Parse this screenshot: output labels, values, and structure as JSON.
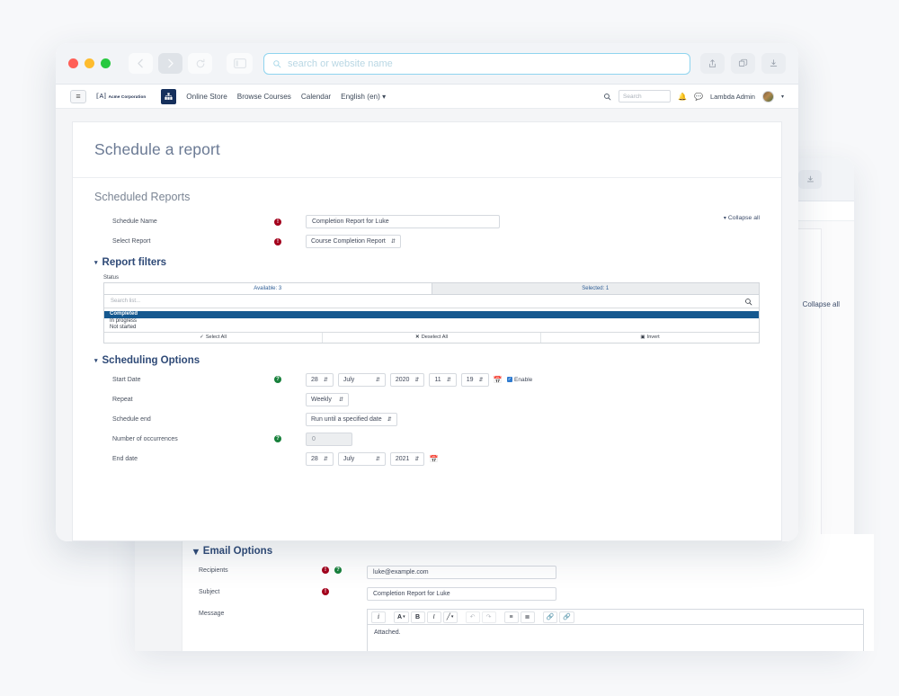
{
  "browser": {
    "url_placeholder": "search or website name",
    "buttons": {
      "back": "back-icon",
      "forward": "forward-icon",
      "reload": "reload-icon",
      "sidebar": "sidebar-icon",
      "share": "share-icon",
      "tabs": "tabs-icon",
      "download": "download-icon"
    }
  },
  "sitenav": {
    "menu": "≡",
    "brand": "Acme Corporation",
    "links": [
      "Online Store",
      "Browse Courses",
      "Calendar",
      "English (en)"
    ],
    "lang_caret": "▾",
    "search_placeholder": "Search",
    "user": "Lambda Admin",
    "user_caret": "▾"
  },
  "page": {
    "title": "Schedule a report",
    "section_title": "Scheduled Reports",
    "collapse_all": "Collapse all"
  },
  "form": {
    "schedule_name": {
      "label": "Schedule Name",
      "value": "Completion Report for Luke"
    },
    "select_report": {
      "label": "Select Report",
      "value": "Course Completion Report"
    }
  },
  "report_filters": {
    "heading": "Report filters",
    "status_label": "Status",
    "tab_available": "Available: 3",
    "tab_selected": "Selected: 1",
    "search_placeholder": "Search list...",
    "items": [
      "Completed",
      "In progress",
      "Not started"
    ],
    "selected_item": "Completed",
    "buttons": {
      "select_all": "Select All",
      "deselect_all": "Deselect All",
      "invert": "Invert"
    }
  },
  "scheduling": {
    "heading": "Scheduling Options",
    "start_date": {
      "label": "Start Date",
      "day": "28",
      "month": "July",
      "year": "2020",
      "hour": "11",
      "minute": "19",
      "enable_label": "Enable",
      "enabled": true
    },
    "repeat": {
      "label": "Repeat",
      "value": "Weekly"
    },
    "schedule_end": {
      "label": "Schedule end",
      "value": "Run until a specified date"
    },
    "occurrences": {
      "label": "Number of occurrences",
      "value": "0"
    },
    "end_date": {
      "label": "End date",
      "day": "28",
      "month": "July",
      "year": "2021"
    }
  },
  "email_options": {
    "heading": "Email Options",
    "recipients": {
      "label": "Recipients",
      "value": "luke@example.com"
    },
    "subject": {
      "label": "Subject",
      "value": "Completion Report for Luke"
    },
    "message": {
      "label": "Message",
      "value": "Attached."
    },
    "toolbar": [
      "paragraph-style",
      "font-color",
      "bold",
      "italic",
      "highlight",
      "undo",
      "redo",
      "unordered-list",
      "ordered-list",
      "link",
      "unlink"
    ]
  },
  "back_window": {
    "collapse_all": "Collapse all"
  },
  "colors": {
    "accent_blue": "#15588f",
    "heading_blue": "#2f4a77",
    "required_red": "#a3001c",
    "help_green": "#17803b",
    "page_bg": "#f7f8fa"
  }
}
